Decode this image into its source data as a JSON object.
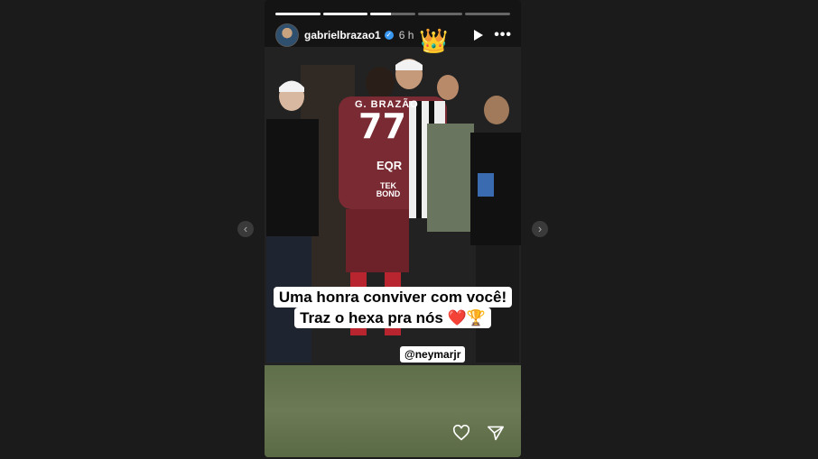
{
  "story": {
    "username": "gabrielbrazao1",
    "time": "6 h",
    "crown_emoji": "👑",
    "progress": [
      1,
      1,
      0.45,
      0,
      0
    ],
    "caption_line1": "Uma honra conviver com você!",
    "caption_line2": "Traz o hexa pra nós ❤️🏆",
    "mention": "@neymarjr"
  },
  "photo": {
    "jersey_name": "G. BRAZÃO",
    "jersey_number": "77",
    "sponsor1": "EQR",
    "sponsor2": "TEK BOND"
  },
  "icons": {
    "verified": "verified-badge-icon",
    "play": "play-icon",
    "more": "more-options-icon",
    "like": "heart-icon",
    "share": "send-icon",
    "prev": "chevron-left-icon",
    "next": "chevron-right-icon"
  },
  "colors": {
    "jersey": "#7a2a32",
    "accent_verified": "#3897f0"
  }
}
